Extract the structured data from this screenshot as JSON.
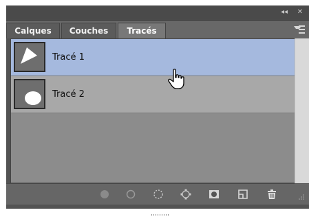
{
  "panel": {
    "controls": {
      "collapse_glyph": "◂◂",
      "close_glyph": "✕"
    },
    "tabs": [
      {
        "label": "Calques"
      },
      {
        "label": "Couches"
      },
      {
        "label": "Tracés"
      }
    ],
    "active_tab": "Tracés"
  },
  "paths": [
    {
      "label": "Tracé 1",
      "selected": true,
      "thumbnail": "triangle-shape"
    },
    {
      "label": "Tracé 2",
      "selected": false,
      "thumbnail": "ellipse-shape"
    }
  ],
  "bottom_toolbar": [
    "fill-path-icon",
    "stroke-path-icon",
    "load-as-selection-icon",
    "make-work-path-icon",
    "add-mask-icon",
    "new-path-icon",
    "delete-path-icon"
  ],
  "colors": {
    "selected_row": "#a5b9de",
    "row": "#a8a8a8",
    "panel_bg": "#535353"
  }
}
